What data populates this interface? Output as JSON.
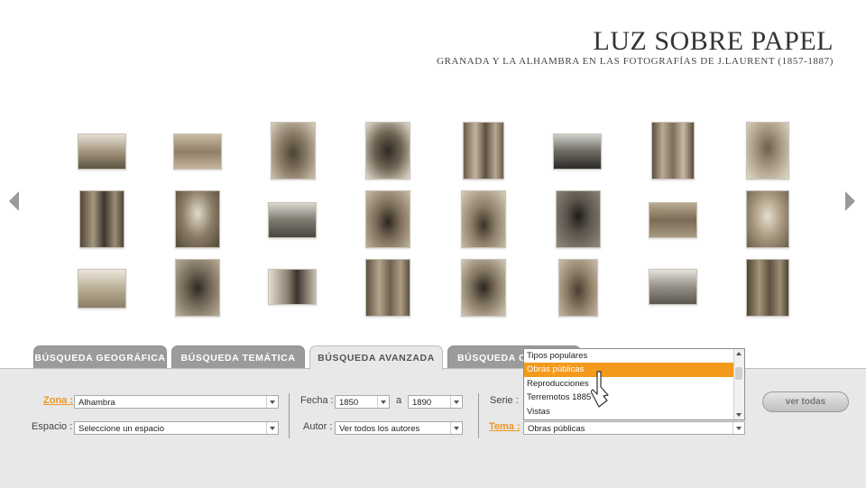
{
  "header": {
    "title": "LUZ SOBRE PAPEL",
    "subtitle": "GRANADA Y LA ALHAMBRA EN LAS FOTOGRAFÍAS DE J.LAURENT  (1857-1887)"
  },
  "tabs": [
    {
      "label": "BÚSQUEDA GEOGRÁFICA"
    },
    {
      "label": "BÚSQUEDA TEMÁTICA"
    },
    {
      "label": "BÚSQUEDA AVANZADA"
    },
    {
      "label": "BÚSQUEDA CRO"
    }
  ],
  "filters": {
    "zona_label": "Zona :",
    "zona_value": "Alhambra",
    "espacio_label": "Espacio :",
    "espacio_value": "Seleccione un espacio",
    "fecha_label": "Fecha :",
    "fecha_from": "1850",
    "fecha_sep": "a",
    "fecha_to": "1890",
    "autor_label": "Autor :",
    "autor_value": "Ver todos los autores",
    "serie_label": "Serie :",
    "tema_label": "Tema :",
    "tema_value": "Obras públicas"
  },
  "dropdown": {
    "items": [
      "Tipos populares",
      "Obras públicas",
      "Reproducciones",
      "Terremotos 1885",
      "Vistas"
    ],
    "selected": "Obras públicas"
  },
  "button": {
    "label": "ver todas"
  },
  "colors": {
    "accent": "#f39a1d",
    "tab_inactive": "#9b9b9b",
    "panel": "#e8e8e8"
  }
}
